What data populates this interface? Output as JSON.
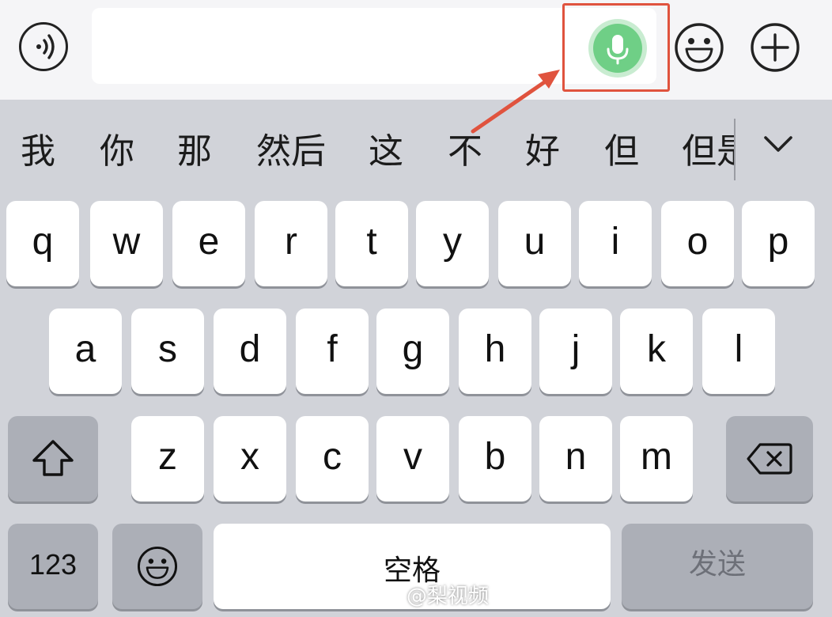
{
  "top_bar": {
    "voice_icon": "voice-wave-icon",
    "mic_icon": "microphone-icon",
    "emoji_icon": "smiley-icon",
    "plus_icon": "plus-circle-icon",
    "input_value": ""
  },
  "candidates": [
    "我",
    "你",
    "那",
    "然后",
    "这",
    "不",
    "好",
    "但",
    "但是"
  ],
  "candidates_toggle_icon": "chevron-down-icon",
  "keyboard": {
    "row1": [
      "q",
      "w",
      "e",
      "r",
      "t",
      "y",
      "u",
      "i",
      "o",
      "p"
    ],
    "row2": [
      "a",
      "s",
      "d",
      "f",
      "g",
      "h",
      "j",
      "k",
      "l"
    ],
    "row3": [
      "z",
      "x",
      "c",
      "v",
      "b",
      "n",
      "m"
    ],
    "shift_icon": "shift-icon",
    "delete_icon": "backspace-icon",
    "numbers_label": "123",
    "emoji_key_icon": "smiley-icon",
    "space_label": "空格",
    "send_label": "发送"
  },
  "watermark": {
    "text": "@梨视频",
    "logo": "weibo-logo"
  },
  "colors": {
    "highlight": "#e0533e",
    "mic_green": "#6fcf86",
    "keyboard_bg": "#d1d3d9"
  }
}
